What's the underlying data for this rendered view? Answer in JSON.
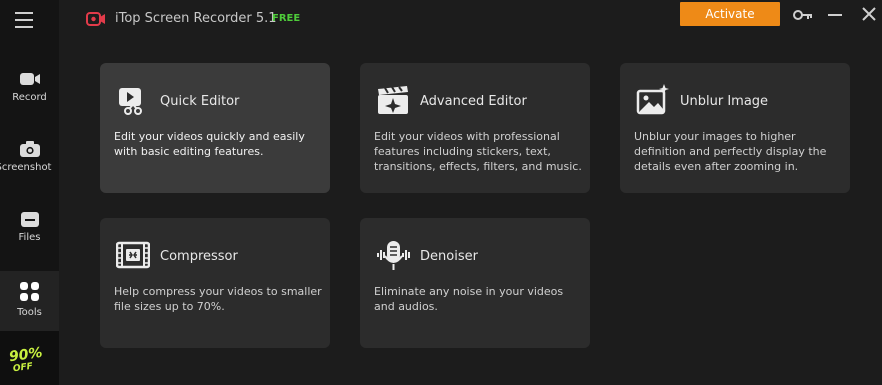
{
  "app": {
    "title": "iTop Screen Recorder 5.1",
    "badge": "FREE",
    "activate_label": "Activate"
  },
  "sidebar": {
    "items": [
      {
        "label": "Record"
      },
      {
        "label": "Screenshot"
      },
      {
        "label": "Files"
      },
      {
        "label": "Tools"
      }
    ],
    "promo": {
      "big": "90%",
      "small": "OFF"
    }
  },
  "tools": [
    {
      "title": "Quick Editor",
      "desc": "Edit your videos quickly and easily with basic editing features."
    },
    {
      "title": "Advanced Editor",
      "desc": "Edit your videos with professional features including stickers, text, transitions, effects, filters, and music."
    },
    {
      "title": "Unblur Image",
      "desc": "Unblur your images to higher definition and perfectly display the details even after zooming in."
    },
    {
      "title": "Compressor",
      "desc": "Help compress your videos to smaller file sizes up to 70%."
    },
    {
      "title": "Denoiser",
      "desc": "Eliminate any noise in your videos and audios."
    }
  ]
}
